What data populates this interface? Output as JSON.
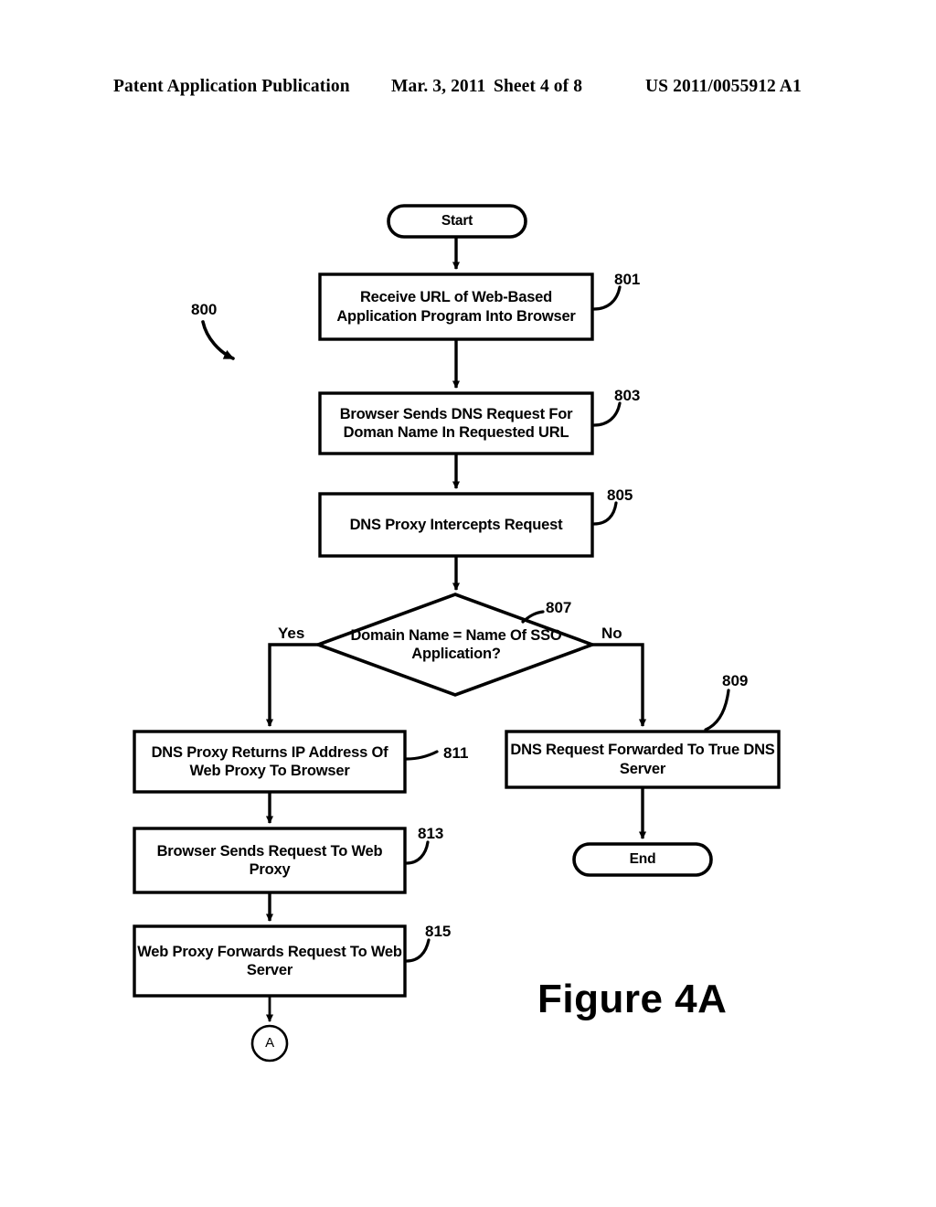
{
  "page_header": {
    "publication": "Patent Application Publication",
    "date": "Mar. 3, 2011",
    "sheet": "Sheet 4 of 8",
    "publication_number": "US 2011/0055912 A1"
  },
  "figure": {
    "caption": "Figure 4A",
    "diagram_reference": "800"
  },
  "flowchart": {
    "type": "flowchart",
    "nodes": [
      {
        "id": "start",
        "shape": "terminator",
        "label": "Start",
        "ref": ""
      },
      {
        "id": "n801",
        "shape": "process",
        "label": "Receive URL of Web-Based Application Program Into Browser",
        "ref": "801"
      },
      {
        "id": "n803",
        "shape": "process",
        "label": "Browser Sends DNS Request For Doman Name In Requested URL",
        "ref": "803"
      },
      {
        "id": "n805",
        "shape": "process",
        "label": "DNS Proxy Intercepts Request",
        "ref": "805"
      },
      {
        "id": "n807",
        "shape": "decision",
        "label": "Domain Name = Name Of SSO Application?",
        "ref": "807"
      },
      {
        "id": "n809",
        "shape": "process",
        "label": "DNS Request Forwarded To True DNS Server",
        "ref": "809"
      },
      {
        "id": "n811",
        "shape": "process",
        "label": "DNS Proxy Returns IP Address Of Web Proxy To Browser",
        "ref": "811"
      },
      {
        "id": "n813",
        "shape": "process",
        "label": "Browser Sends Request To Web Proxy",
        "ref": "813"
      },
      {
        "id": "n815",
        "shape": "process",
        "label": "Web Proxy Forwards Request To Web Server",
        "ref": "815"
      },
      {
        "id": "end",
        "shape": "terminator",
        "label": "End",
        "ref": ""
      },
      {
        "id": "conn_a",
        "shape": "connector",
        "label": "A",
        "ref": ""
      }
    ],
    "branch_labels": {
      "yes": "Yes",
      "no": "No"
    },
    "edges": [
      {
        "from": "start",
        "to": "n801",
        "label": ""
      },
      {
        "from": "n801",
        "to": "n803",
        "label": ""
      },
      {
        "from": "n803",
        "to": "n805",
        "label": ""
      },
      {
        "from": "n805",
        "to": "n807",
        "label": ""
      },
      {
        "from": "n807",
        "to": "n811",
        "label": "Yes"
      },
      {
        "from": "n807",
        "to": "n809",
        "label": "No"
      },
      {
        "from": "n811",
        "to": "n813",
        "label": ""
      },
      {
        "from": "n813",
        "to": "n815",
        "label": ""
      },
      {
        "from": "n815",
        "to": "conn_a",
        "label": ""
      },
      {
        "from": "n809",
        "to": "end",
        "label": ""
      }
    ]
  },
  "colors": {
    "ink": "#000000",
    "paper": "#ffffff"
  }
}
